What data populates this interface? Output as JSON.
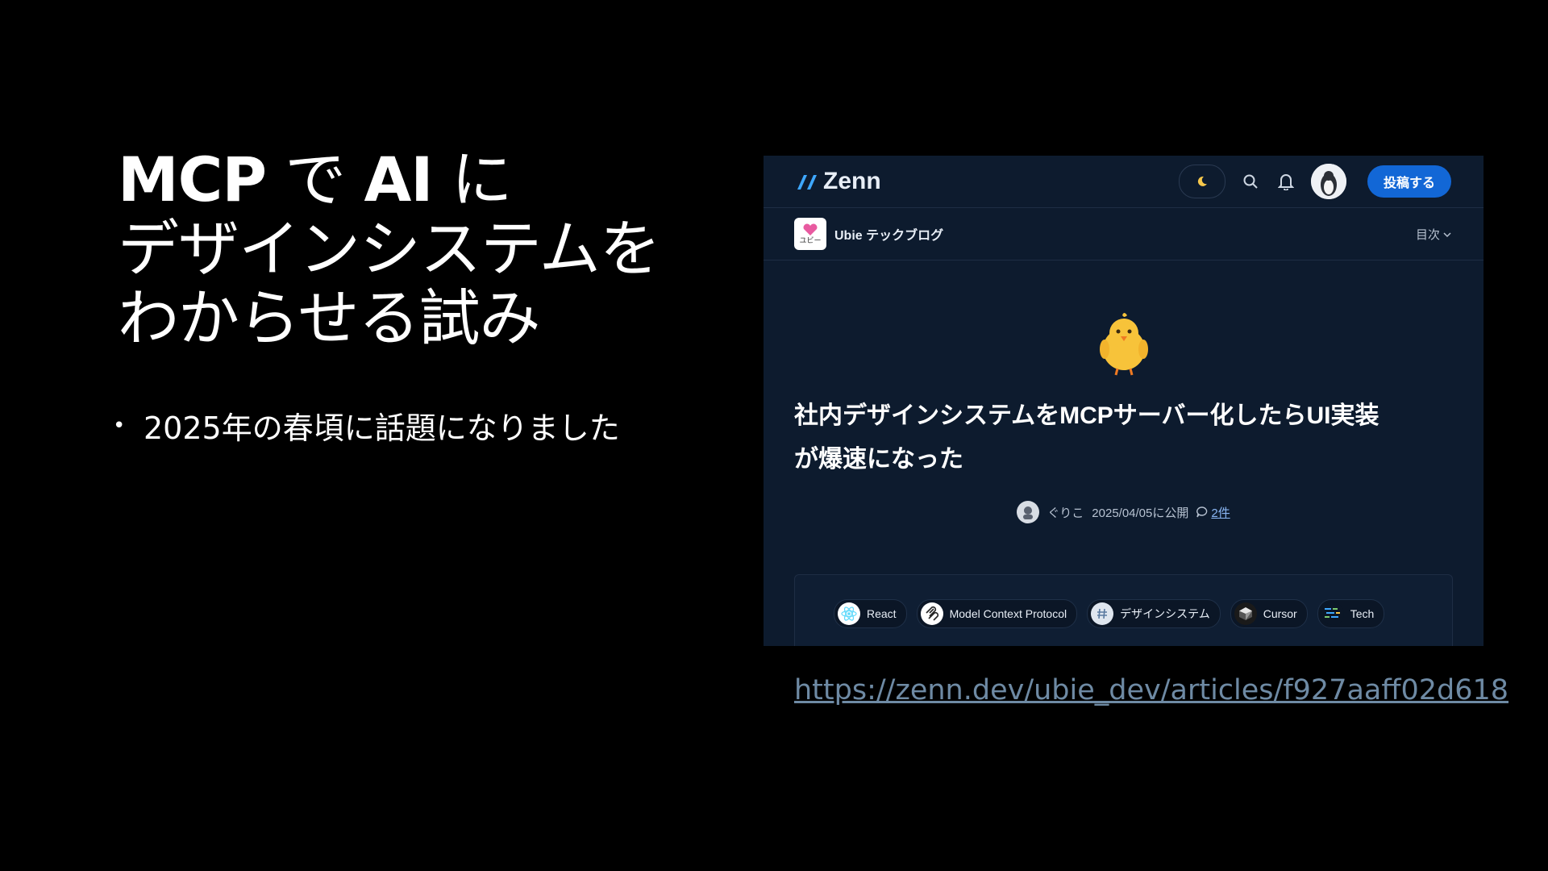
{
  "slide": {
    "title_line1_bold_a": "MCP",
    "title_line1_mid": " で ",
    "title_line1_bold_b": "AI",
    "title_line1_end": " に",
    "title_line2": "デザインシステムを",
    "title_line3": "わからせる試み",
    "bullets": [
      "2025年の春頃に話題になりました"
    ],
    "bullet_marker": "•",
    "link_url": "https://zenn.dev/ubie_dev/articles/f927aaff02d618"
  },
  "zenn": {
    "logo_text": "Zenn",
    "post_button": "投稿する",
    "publication_name": "Ubie テックブログ",
    "publication_logo_text": "ユビー",
    "toc_label": "目次",
    "article_title_line1": "社内デザインシステムをMCPサーバー化したらUI実装",
    "article_title_line2": "が爆速になった",
    "author": "ぐりこ",
    "published": "2025/04/05に公開",
    "comments": "2件",
    "topics": [
      {
        "label": "React",
        "icon": "react-icon"
      },
      {
        "label": "Model Context Protocol",
        "icon": "mcp-icon"
      },
      {
        "label": "デザインシステム",
        "icon": "hash-icon"
      },
      {
        "label": "Cursor",
        "icon": "cursor-icon"
      },
      {
        "label": "Tech",
        "icon": "tech-icon"
      }
    ],
    "colors": {
      "background": "#0d1b2e",
      "accent": "#1267d6",
      "logo_blue": "#3ea8ff"
    }
  }
}
